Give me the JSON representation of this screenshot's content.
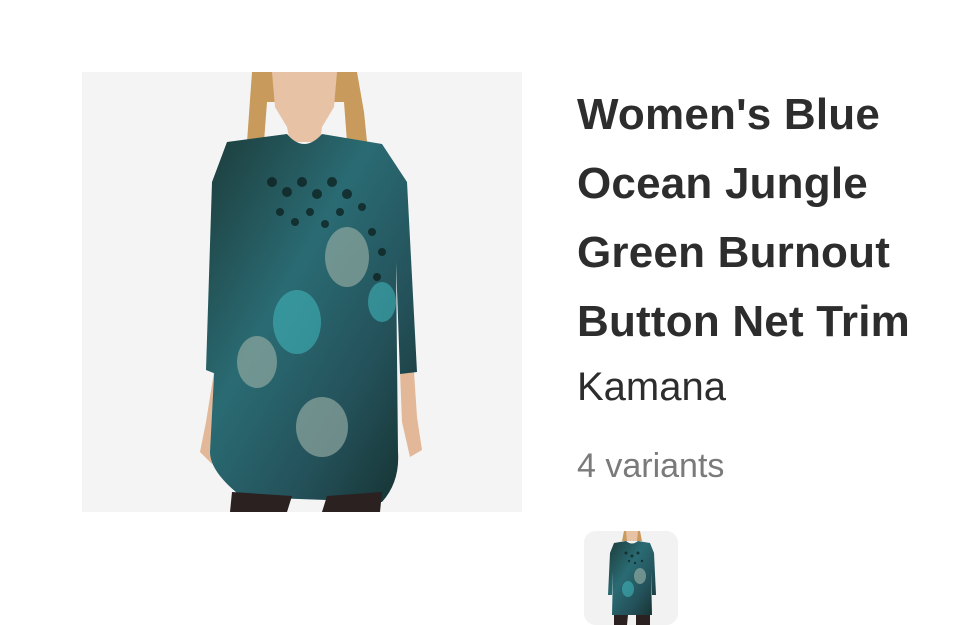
{
  "product": {
    "title_lines": [
      "Women's Blue",
      "Ocean Jungle",
      "Green Burnout",
      "Button Net Trim"
    ],
    "brand": "Kamana",
    "variants_label": "4 variants",
    "main_image": "product-photo-tunic",
    "thumbnail_image": "variant-thumbnail-tunic"
  },
  "colors": {
    "text_primary": "#2d2d2d",
    "text_secondary": "#7a7a7a",
    "image_background": "#f4f4f4"
  }
}
